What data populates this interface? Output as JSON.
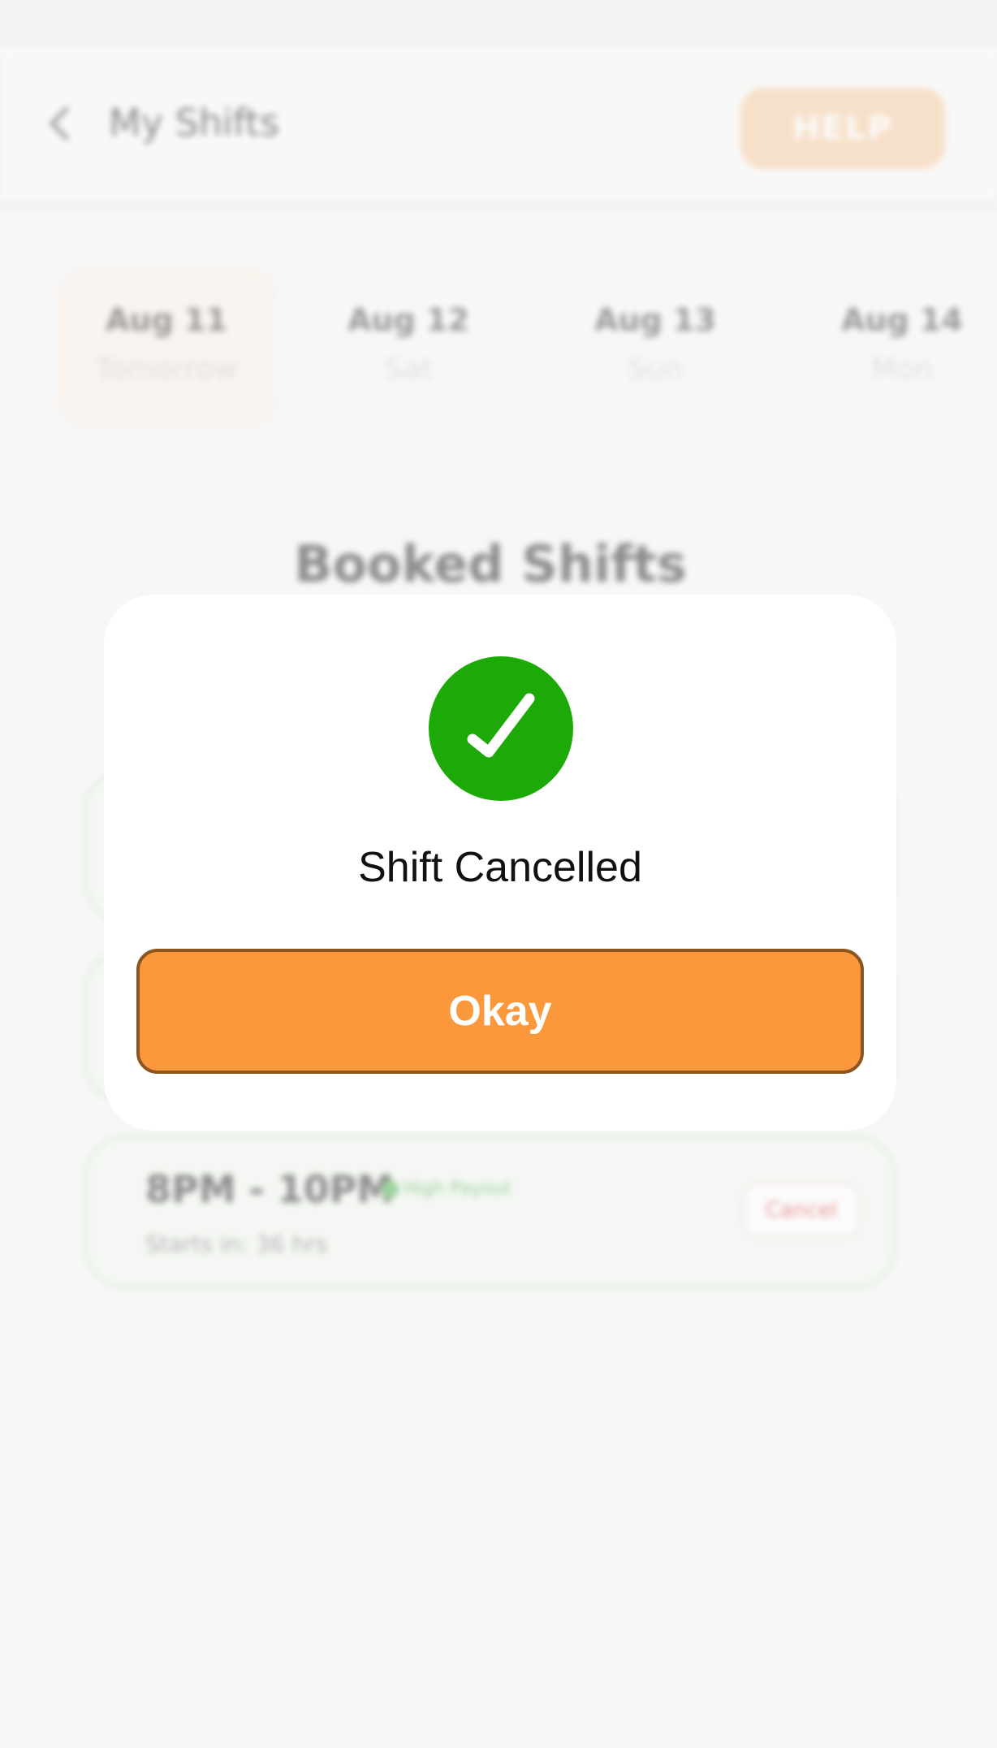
{
  "header": {
    "title": "My Shifts",
    "help_label": "HELP"
  },
  "dates": [
    {
      "date": "Aug 11",
      "day": "Tomorrow",
      "selected": true
    },
    {
      "date": "Aug 12",
      "day": "Sat",
      "selected": false
    },
    {
      "date": "Aug 13",
      "day": "Sun",
      "selected": false
    },
    {
      "date": "Aug 14",
      "day": "Mon",
      "selected": false
    }
  ],
  "section_title": "Booked Shifts",
  "shifts": [
    {
      "time": "8PM - 10PM",
      "badge": "High Payout",
      "starts_in": "Starts in: 36 hrs",
      "cancel_label": "Cancel"
    }
  ],
  "modal": {
    "icon": "check-icon",
    "message": "Shift Cancelled",
    "button_label": "Okay"
  },
  "colors": {
    "accent_orange": "#fb983c",
    "button_border": "#8d5621",
    "success_green": "#1daa08",
    "help_button": "#f7cfa7",
    "shift_card_border": "#d5ecd2"
  }
}
